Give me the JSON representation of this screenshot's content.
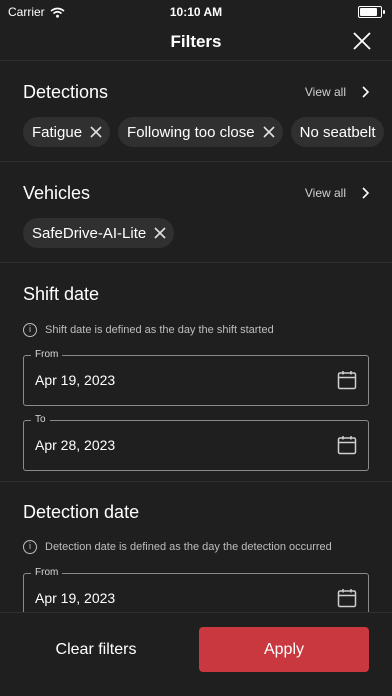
{
  "status_bar": {
    "carrier": "Carrier",
    "time": "10:10 AM",
    "wifi_icon": "wifi-icon",
    "battery_icon": "battery-icon"
  },
  "nav": {
    "title": "Filters",
    "close_icon": "close-icon"
  },
  "detections": {
    "title": "Detections",
    "view_all": "View all",
    "chips": [
      "Fatigue",
      "Following too close",
      "No seatbelt"
    ]
  },
  "vehicles": {
    "title": "Vehicles",
    "view_all": "View all",
    "chips": [
      "SafeDrive-AI-Lite"
    ]
  },
  "shift_date": {
    "title": "Shift date",
    "info": "Shift date is defined as the day the shift started",
    "from_label": "From",
    "from_value": "Apr 19, 2023",
    "to_label": "To",
    "to_value": "Apr 28, 2023"
  },
  "detection_date": {
    "title": "Detection date",
    "info": "Detection date is defined as the day the detection occurred",
    "from_label": "From",
    "from_value": "Apr 19, 2023"
  },
  "footer": {
    "clear_label": "Clear filters",
    "apply_label": "Apply"
  },
  "colors": {
    "background": "#1f1f1f",
    "chip": "#303030",
    "apply": "#c9383e"
  }
}
